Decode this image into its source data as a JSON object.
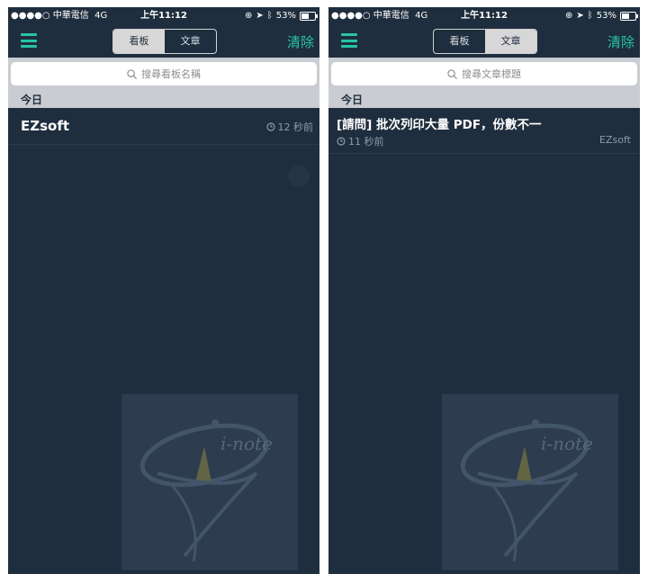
{
  "status_bar": {
    "carrier": "●●●●○ 中華電信",
    "network": "4G",
    "time": "上午11:12",
    "battery": "53%"
  },
  "nav": {
    "seg_board": "看板",
    "seg_article": "文章",
    "clear": "清除"
  },
  "left": {
    "search_placeholder": "搜尋看板名稱",
    "section": "今日",
    "board": {
      "name": "EZsoft",
      "time": "12 秒前"
    }
  },
  "right": {
    "search_placeholder": "搜尋文章標題",
    "section": "今日",
    "post": {
      "title": "[請問] 批次列印大量 PDF，份數不一",
      "time": "11 秒前",
      "author": "EZsoft"
    }
  },
  "watermark": {
    "text": "i-note"
  },
  "colors": {
    "accent": "#26c6a4",
    "background": "#1f2e3e",
    "separator": "#c9ccd2"
  }
}
